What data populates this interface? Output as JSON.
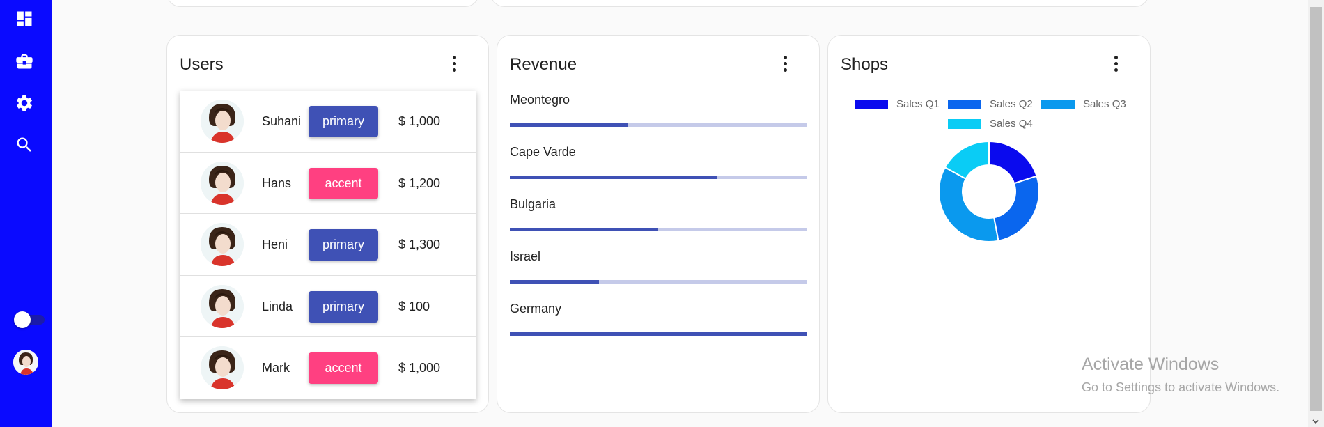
{
  "sidebar": {
    "icons": [
      "dashboard-icon",
      "briefcase-icon",
      "settings-icon",
      "search-icon"
    ],
    "color": "#0a0aff"
  },
  "users_card": {
    "title": "Users",
    "users": [
      {
        "name": "Suhani",
        "tag": "primary",
        "amount": "$ 1,000"
      },
      {
        "name": "Hans",
        "tag": "accent",
        "amount": "$ 1,200"
      },
      {
        "name": "Heni",
        "tag": "primary",
        "amount": "$ 1,300"
      },
      {
        "name": "Linda",
        "tag": "primary",
        "amount": "$ 100"
      },
      {
        "name": "Mark",
        "tag": "accent",
        "amount": "$ 1,000"
      }
    ],
    "colors": {
      "primary": "#3f51b5",
      "accent": "#ff4081"
    }
  },
  "revenue_card": {
    "title": "Revenue",
    "items": [
      {
        "country": "Meontegro",
        "progress": 0.4
      },
      {
        "country": "Cape Varde",
        "progress": 0.7
      },
      {
        "country": "Bulgaria",
        "progress": 0.5
      },
      {
        "country": "Israel",
        "progress": 0.3
      },
      {
        "country": "Germany",
        "progress": 1.0
      }
    ]
  },
  "shops_card": {
    "title": "Shops"
  },
  "chart_data": {
    "type": "pie",
    "variant": "doughnut",
    "categories": [
      "Sales Q1",
      "Sales Q2",
      "Sales Q3",
      "Sales Q4"
    ],
    "values": [
      20,
      27,
      36,
      17
    ],
    "colors": [
      "#0a0aee",
      "#0a66ee",
      "#0a99ee",
      "#0accf5"
    ],
    "legend": "top"
  },
  "watermark": {
    "title": "Activate Windows",
    "subtitle": "Go to Settings to activate Windows."
  }
}
